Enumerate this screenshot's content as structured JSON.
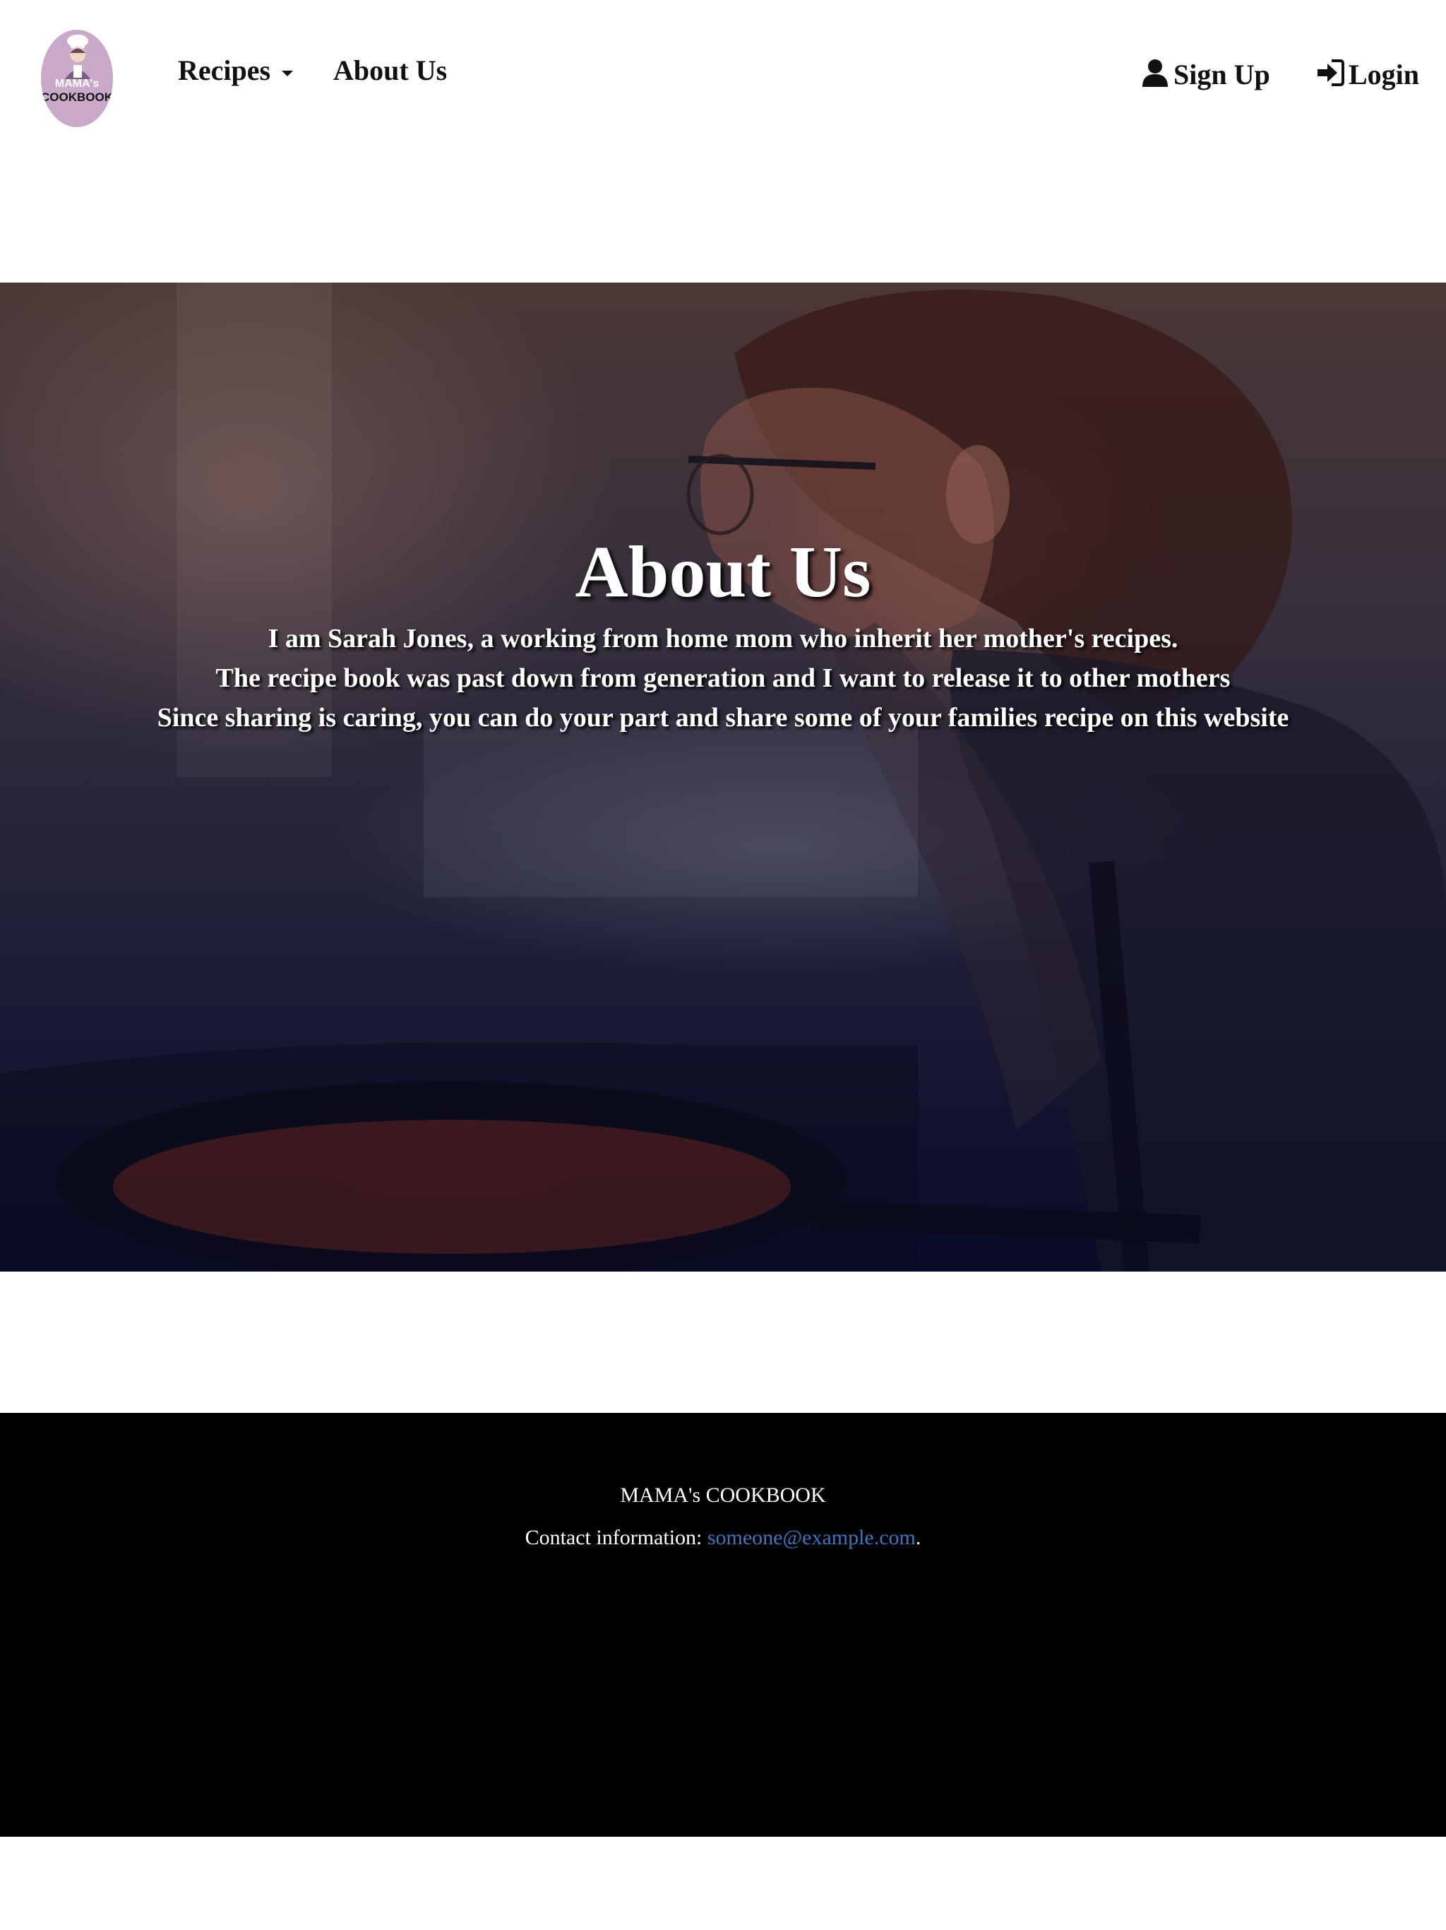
{
  "navbar": {
    "logo": {
      "line_1": "MAMA's",
      "line_2": "COOKBOOK",
      "color": "#c9a9c9"
    },
    "recipes_label": "Recipes",
    "about_label": "About Us",
    "signup_label": "Sign Up",
    "signup_icon": "user-icon",
    "login_label": "Login",
    "login_icon": "log-in-icon"
  },
  "hero": {
    "title": "About Us",
    "lines": [
      "I am Sarah Jones, a working from home mom who inherit her mother's recipes.",
      "The recipe book was past down from generation and I want to release it to other mothers",
      "Since sharing is caring, you can do your part and share some of your families recipe on this website"
    ]
  },
  "footer": {
    "brand": "MAMA's COOKBOOK",
    "contact_label": "Contact information: ",
    "email": "someone@example.com",
    "trailing": ".",
    "link_color": "#3a76c4"
  }
}
